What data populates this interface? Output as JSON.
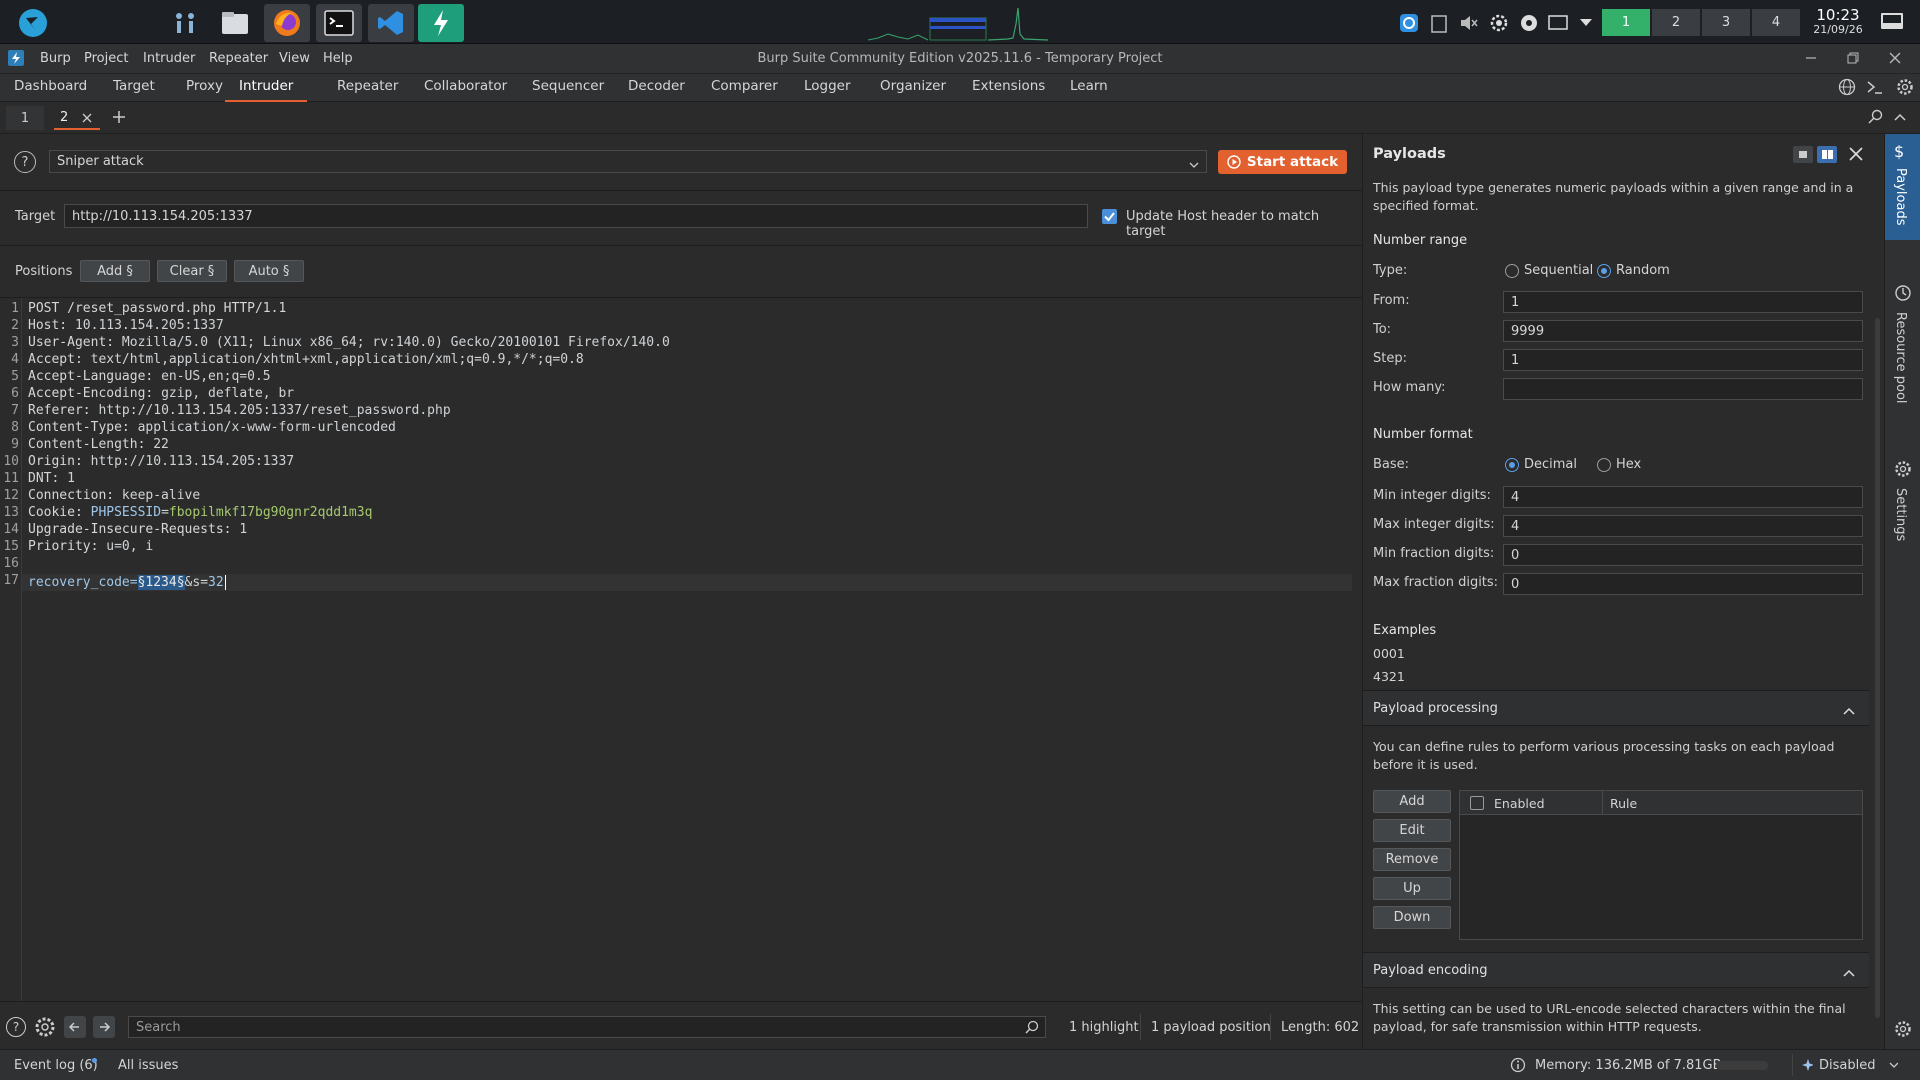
{
  "taskbar": {
    "workspaces": [
      "1",
      "2",
      "3",
      "4"
    ],
    "active_workspace": "1",
    "clock_time": "10:23",
    "clock_date": "21/09/26"
  },
  "window": {
    "title": "Burp Suite Community Edition v2025.11.6 - Temporary Project",
    "menu": [
      "Burp",
      "Project",
      "Intruder",
      "Repeater",
      "View",
      "Help"
    ]
  },
  "main_tabs": [
    "Dashboard",
    "Target",
    "Proxy",
    "Intruder",
    "Repeater",
    "Collaborator",
    "Sequencer",
    "Decoder",
    "Comparer",
    "Logger",
    "Organizer",
    "Extensions",
    "Learn"
  ],
  "active_main_tab": "Intruder",
  "sub_tabs": {
    "tab1": "1",
    "tab2": "2"
  },
  "attack": {
    "type": "Sniper attack",
    "start_label": "Start attack",
    "target_label": "Target",
    "target_value": "http://10.113.154.205:1337",
    "update_host_label": "Update Host header to match target",
    "update_host_checked": true
  },
  "positions": {
    "label": "Positions",
    "add": "Add §",
    "clear": "Clear §",
    "auto": "Auto §"
  },
  "request_lines": [
    {
      "n": "1",
      "k": "POST /reset_password.php HTTP/1.1",
      "v": ""
    },
    {
      "n": "2",
      "k": "Host: ",
      "v": "10.113.154.205:1337"
    },
    {
      "n": "3",
      "k": "User-Agent: ",
      "v": "Mozilla/5.0 (X11; Linux x86_64; rv:140.0) Gecko/20100101 Firefox/140.0"
    },
    {
      "n": "4",
      "k": "Accept: ",
      "v": "text/html,application/xhtml+xml,application/xml;q=0.9,*/*;q=0.8"
    },
    {
      "n": "5",
      "k": "Accept-Language: ",
      "v": "en-US,en;q=0.5"
    },
    {
      "n": "6",
      "k": "Accept-Encoding: ",
      "v": "gzip, deflate, br"
    },
    {
      "n": "7",
      "k": "Referer: ",
      "v": "http://10.113.154.205:1337/reset_password.php"
    },
    {
      "n": "8",
      "k": "Content-Type: ",
      "v": "application/x-www-form-urlencoded"
    },
    {
      "n": "9",
      "k": "Content-Length: ",
      "v": "22"
    },
    {
      "n": "10",
      "k": "Origin: ",
      "v": "http://10.113.154.205:1337"
    },
    {
      "n": "11",
      "k": "DNT: ",
      "v": "1"
    },
    {
      "n": "12",
      "k": "Connection: ",
      "v": "keep-alive"
    },
    {
      "n": "13",
      "k": "Cookie: ",
      "v": ""
    },
    {
      "n": "14",
      "k": "Upgrade-Insecure-Requests: ",
      "v": "1"
    },
    {
      "n": "15",
      "k": "Priority: ",
      "v": "u=0, i"
    },
    {
      "n": "16",
      "k": "",
      "v": ""
    },
    {
      "n": "17",
      "k": "",
      "v": ""
    }
  ],
  "cookie": {
    "name": "PHPSESSID",
    "eq": "=",
    "value": "fbopilmkf17bg90gnr2qdd1m3q"
  },
  "body_line": {
    "p1": "recovery_code=",
    "marker": "§1234§",
    "mid": "&s=",
    "val": "32"
  },
  "status": {
    "search_placeholder": "Search",
    "highlights": "1 highlight",
    "payload_positions": "1 payload position",
    "length": "Length: 602"
  },
  "payloads": {
    "title": "Payloads",
    "description": "This payload type generates numeric payloads within a given range and in a specified format.",
    "number_range_title": "Number range",
    "type_label": "Type:",
    "type_options": [
      "Sequential",
      "Random"
    ],
    "type_selected": "Random",
    "from_label": "From:",
    "from_value": "1",
    "to_label": "To:",
    "to_value": "9999",
    "step_label": "Step:",
    "step_value": "1",
    "howmany_label": "How many:",
    "howmany_value": "",
    "number_format_title": "Number format",
    "base_label": "Base:",
    "base_options": [
      "Decimal",
      "Hex"
    ],
    "base_selected": "Decimal",
    "min_int_label": "Min integer digits:",
    "min_int_value": "4",
    "max_int_label": "Max integer digits:",
    "max_int_value": "4",
    "min_frac_label": "Min fraction digits:",
    "min_frac_value": "0",
    "max_frac_label": "Max fraction digits:",
    "max_frac_value": "0",
    "examples_title": "Examples",
    "examples": [
      "0001",
      "4321"
    ],
    "processing_title": "Payload processing",
    "processing_desc": "You can define rules to perform various processing tasks on each payload before it is used.",
    "processing_buttons": [
      "Add",
      "Edit",
      "Remove",
      "Up",
      "Down"
    ],
    "rules_headers": [
      "Enabled",
      "Rule"
    ],
    "encoding_title": "Payload encoding",
    "encoding_desc": "This setting can be used to URL-encode selected characters within the final payload, for safe transmission within HTTP requests."
  },
  "side_rail": [
    "Payloads",
    "Resource pool",
    "Settings"
  ],
  "bottom": {
    "event_log": "Event log (6)",
    "all_issues": "All issues",
    "memory": "Memory: 136.2MB of 7.81GB",
    "disabled": "Disabled"
  },
  "colors": {
    "accent": "#e2612e",
    "selection": "#5a9ee8",
    "cookie": "#a6c96f"
  }
}
